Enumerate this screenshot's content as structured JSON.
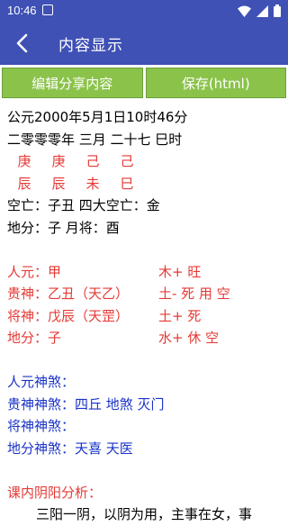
{
  "status": {
    "time": "10:46"
  },
  "appbar": {
    "title": "内容显示"
  },
  "buttons": {
    "edit_share": "编辑分享内容",
    "save_html": "保存(html)"
  },
  "content": {
    "date_line": "公元2000年5月1日10时46分",
    "lunar_line": "二零零零年 三月 二十七 巳时",
    "gan": [
      "庚",
      "庚",
      "己",
      "己"
    ],
    "zhi": [
      "辰",
      "辰",
      "未",
      "巳"
    ],
    "kongwang_line": "空亡：子丑   四大空亡：金",
    "difen_line": "地分：子      月将：酉",
    "rows": [
      {
        "left": "人元：甲",
        "right": "木+ 旺"
      },
      {
        "left": "贵神：乙丑（天乙）",
        "right": "土- 死 用 空"
      },
      {
        "left": "将神：戊辰（天罡）",
        "right": "土+ 死"
      },
      {
        "left": "地分：子",
        "right": "水+ 休 空"
      }
    ],
    "shensha": [
      "人元神煞：",
      "贵神神煞：四丘 地煞 灭门",
      "将神神煞：",
      "地分神煞：天喜 天医"
    ],
    "analysis_title": "课内阴阳分析：",
    "analysis_text": "三阳一阴，以阴为用，主事在女，事"
  }
}
